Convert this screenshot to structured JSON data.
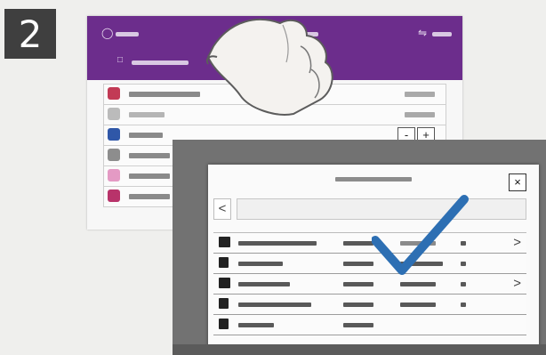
{
  "step_number": "2",
  "dialog": {
    "close_label": "×",
    "back_label": "<",
    "chevron_label": ">"
  },
  "background_screen": {
    "quantity": {
      "minus_label": "-",
      "plus_label": "+"
    }
  },
  "colors": {
    "header": "#6c2d8c",
    "checkmark": "#2d6fb3",
    "step_badge": "#3f3f3f"
  },
  "icons": [
    "user-icon",
    "home-icon",
    "toggle-icon",
    "hand-icon",
    "checkmark-icon",
    "folder-icon",
    "document-icon",
    "close-icon",
    "back-arrow-icon",
    "chevron-right-icon"
  ]
}
